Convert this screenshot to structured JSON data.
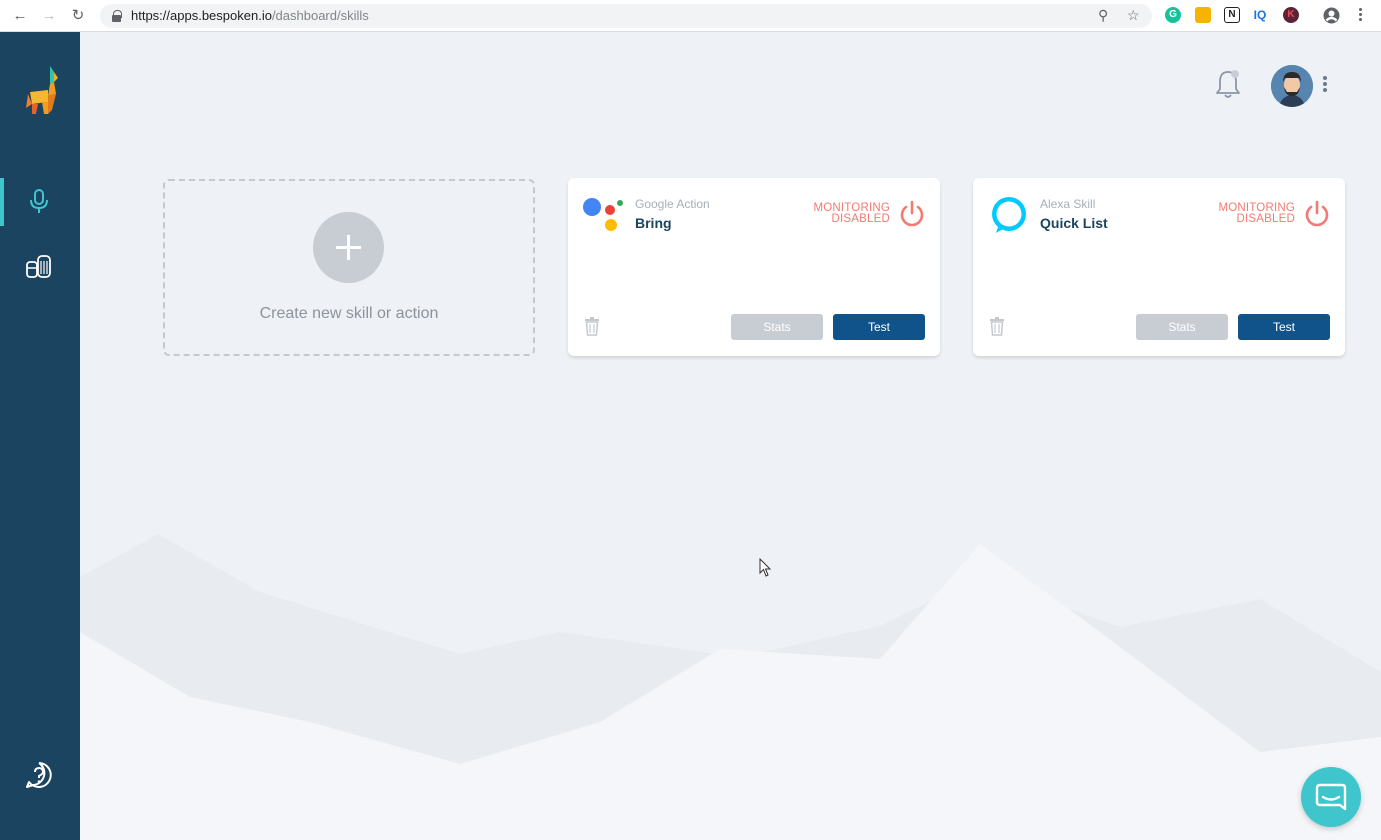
{
  "browser": {
    "url_host": "https://apps.bespoken.io",
    "url_path": "/dashboard/skills",
    "extensions": [
      {
        "name": "grammarly",
        "label": "G",
        "color": "#15c39a"
      },
      {
        "name": "ext-yellow",
        "label": "",
        "color": "#f4b400"
      },
      {
        "name": "notion",
        "label": "N",
        "color": "#202124"
      },
      {
        "name": "iq",
        "label": "IQ",
        "color": "#1a73e8"
      },
      {
        "name": "ext-k",
        "label": "K",
        "color": "#5a2438"
      }
    ]
  },
  "sidebar": {
    "items": [
      {
        "name": "skills",
        "icon": "microphone-icon",
        "active": true
      },
      {
        "name": "sources",
        "icon": "devices-icon",
        "active": false
      },
      {
        "name": "help",
        "icon": "help-icon",
        "active": false
      }
    ],
    "accent": "#3fc5cc",
    "background": "#1b4460"
  },
  "create_card": {
    "label": "Create new skill or action"
  },
  "skills": [
    {
      "type": "Google Action",
      "name": "Bring",
      "platform": "google",
      "monitoring": [
        "MONITORING",
        "DISABLED"
      ],
      "stats_label": "Stats",
      "test_label": "Test"
    },
    {
      "type": "Alexa Skill",
      "name": "Quick List",
      "platform": "alexa",
      "monitoring": [
        "MONITORING",
        "DISABLED"
      ],
      "stats_label": "Stats",
      "test_label": "Test"
    }
  ],
  "colors": {
    "monitoring_disabled": "#f37a73",
    "test_button": "#10538a",
    "stats_button": "#c8ccd3",
    "chat_button": "#3fc5cc"
  }
}
